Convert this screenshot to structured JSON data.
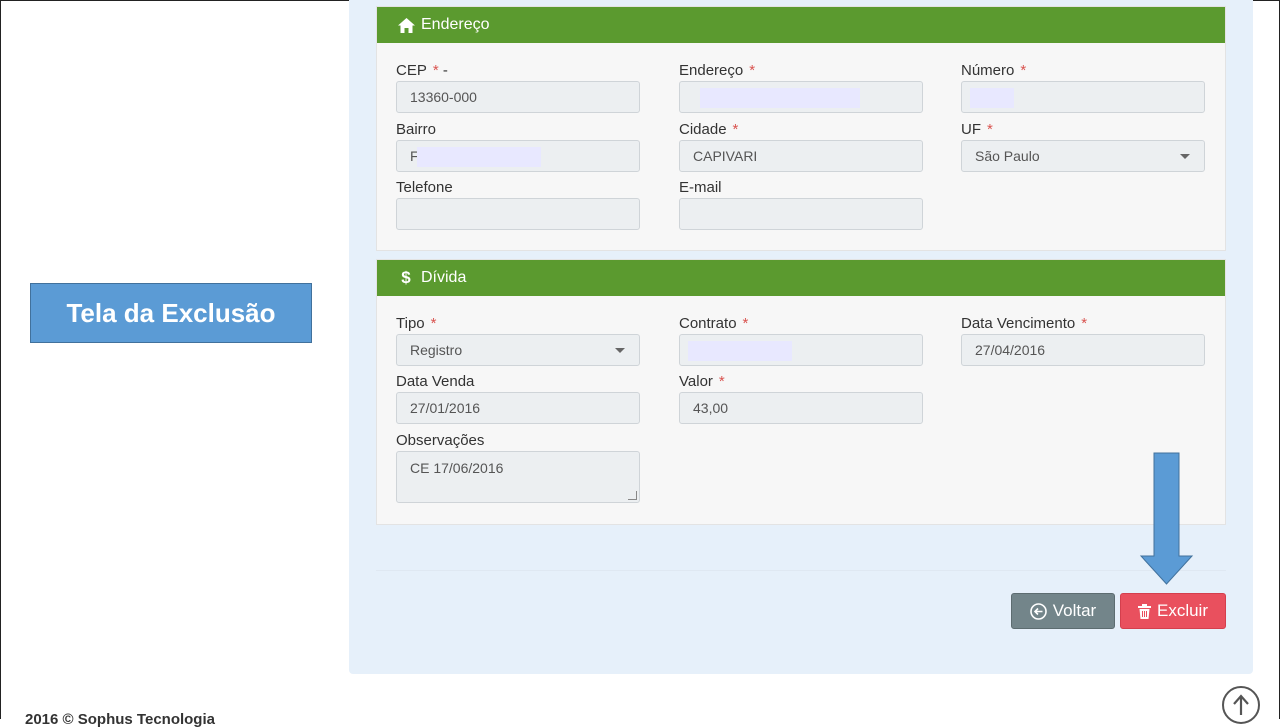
{
  "callout": {
    "text": "Tela da Exclusão"
  },
  "endereco": {
    "title": "Endereço",
    "icon": "home-icon",
    "fields": {
      "cep": {
        "label": "CEP",
        "suffix": "-",
        "value": "13360-000"
      },
      "endereco": {
        "label": "Endereço",
        "value": ""
      },
      "numero": {
        "label": "Número",
        "value": ""
      },
      "bairro": {
        "label": "Bairro",
        "value": "F"
      },
      "cidade": {
        "label": "Cidade",
        "value": "CAPIVARI"
      },
      "uf": {
        "label": "UF",
        "value": "São Paulo"
      },
      "telefone": {
        "label": "Telefone",
        "value": ""
      },
      "email": {
        "label": "E-mail",
        "value": ""
      }
    }
  },
  "divida": {
    "title": "Dívida",
    "icon": "dollar-icon",
    "fields": {
      "tipo": {
        "label": "Tipo",
        "value": "Registro"
      },
      "contrato": {
        "label": "Contrato",
        "value": ""
      },
      "vencimento": {
        "label": "Data Vencimento",
        "value": "27/04/2016"
      },
      "venda": {
        "label": "Data Venda",
        "value": "27/01/2016"
      },
      "valor": {
        "label": "Valor",
        "value": "43,00"
      },
      "observacoes": {
        "label": "Observações",
        "value": "CE 17/06/2016"
      }
    }
  },
  "required_mark": "*",
  "buttons": {
    "voltar": "Voltar",
    "excluir": "Excluir"
  },
  "footer": {
    "text": "2016 © Sophus Tecnologia"
  },
  "colors": {
    "panel_header": "#5b9a2f",
    "delete": "#e9505e",
    "back": "#73858a",
    "callout": "#5b9bd5"
  }
}
